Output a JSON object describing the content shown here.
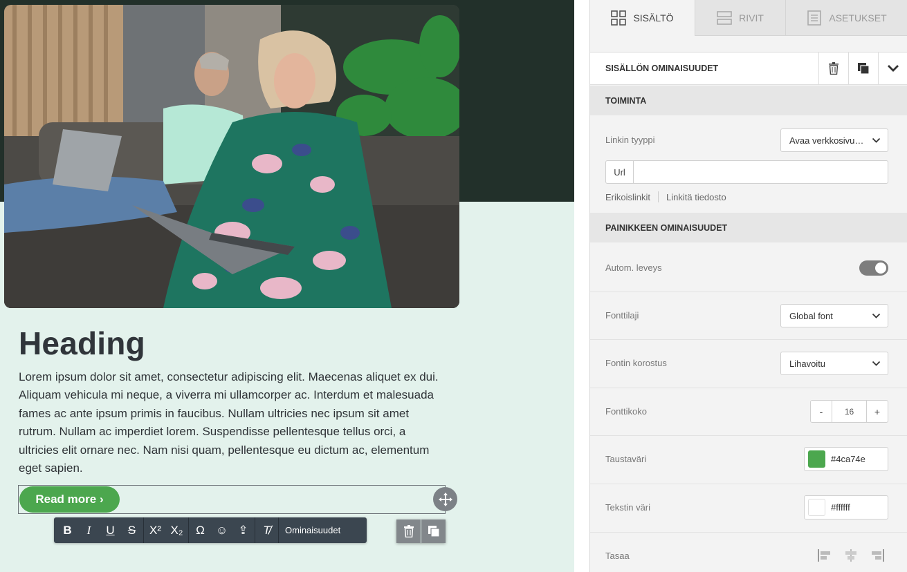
{
  "canvas": {
    "heading": "Heading",
    "body": "Lorem ipsum dolor sit amet, consectetur adipiscing elit. Maecenas aliquet ex dui. Aliquam vehicula mi neque, a viverra mi ullamcorper ac. Interdum et malesuada fames ac ante ipsum primis in faucibus. Nullam ultricies nec ipsum sit amet rutrum. Nullam ac imperdiet lorem. Suspendisse pellentesque tellus orci, a ultricies elit ornare nec. Nam nisi quam, pellentesque eu dictum ac, elementum eget sapien.",
    "button_label": "Read more ›",
    "button_color": "#4ca74e",
    "toolbar": {
      "bold": "B",
      "italic": "I",
      "underline": "U",
      "strikethrough": "S",
      "superscript": "X²",
      "subscript": "X₂",
      "special_char": "Ω",
      "emoji": "☺",
      "upload": "⇪",
      "clear_format": "T̸",
      "properties": "Ominaisuudet"
    }
  },
  "panel": {
    "tabs": [
      {
        "label": "SISÄLTÖ",
        "icon": "grid-icon",
        "active": true
      },
      {
        "label": "RIVIT",
        "icon": "rows-icon",
        "active": false
      },
      {
        "label": "ASETUKSET",
        "icon": "settings-doc-icon",
        "active": false
      }
    ],
    "props_title": "SISÄLLÖN OMINAISUUDET",
    "action_section": "TOIMINTA",
    "link_type_label": "Linkin tyyppi",
    "link_type_value": "Avaa verkkosivusto",
    "url_label": "Url",
    "url_value": "",
    "special_links": "Erikoislinkit",
    "link_file": "Linkitä tiedosto",
    "button_section": "PAINIKKEEN OMINAISUUDET",
    "auto_width_label": "Autom. leveys",
    "auto_width_on": true,
    "font_family_label": "Fonttilaji",
    "font_family_value": "Global font",
    "font_weight_label": "Fontin korostus",
    "font_weight_value": "Lihavoitu",
    "font_size_label": "Fonttikoko",
    "font_size_minus": "-",
    "font_size_value": "16",
    "font_size_plus": "+",
    "bg_color_label": "Taustaväri",
    "bg_color_value": "#4ca74e",
    "text_color_label": "Tekstin väri",
    "text_color_value": "#ffffff",
    "align_label": "Tasaa"
  }
}
